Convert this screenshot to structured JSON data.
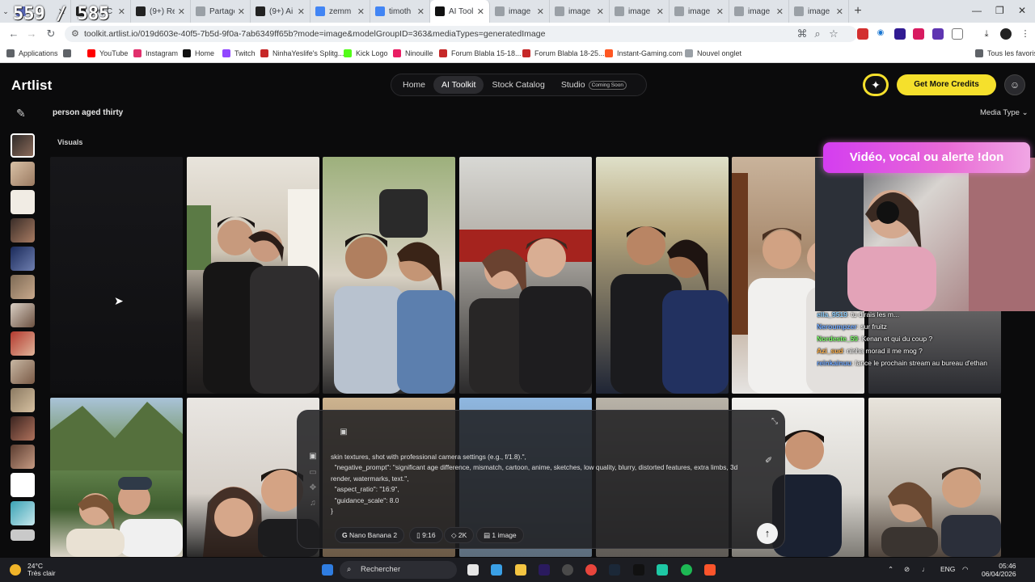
{
  "overlay_counter": "559 / 585",
  "browser": {
    "tabs": [
      {
        "title": "…",
        "color": "#5c6bc0"
      },
      {
        "title": "(9+) C",
        "color": "#222222"
      },
      {
        "title": "(9+) Re",
        "color": "#222222"
      },
      {
        "title": "Partage",
        "color": "#9aa0a6"
      },
      {
        "title": "(9+) Ai",
        "color": "#222222"
      },
      {
        "title": "zemm",
        "color": "#4285f4"
      },
      {
        "title": "timoth",
        "color": "#4285f4"
      },
      {
        "title": "AI Tool",
        "color": "#111111"
      },
      {
        "title": "image",
        "color": "#9aa0a6"
      },
      {
        "title": "image",
        "color": "#9aa0a6"
      },
      {
        "title": "image",
        "color": "#9aa0a6"
      },
      {
        "title": "image",
        "color": "#9aa0a6"
      },
      {
        "title": "image",
        "color": "#9aa0a6"
      },
      {
        "title": "image",
        "color": "#9aa0a6"
      }
    ],
    "url": "toolkit.artlist.io/019d603e-40f5-7b5d-9f0a-7ab6349ff65b?mode=image&modelGroupID=363&mediaTypes=generatedImage",
    "bookmarks": [
      {
        "label": "Applications",
        "color": "#5f6368"
      },
      {
        "label": "",
        "color": "#5f6368"
      },
      {
        "label": "YouTube",
        "color": "#ff0000"
      },
      {
        "label": "Instagram",
        "color": "#e1306c"
      },
      {
        "label": "Home",
        "color": "#111111"
      },
      {
        "label": "Twitch",
        "color": "#9146ff"
      },
      {
        "label": "NinhaYeslife's Splitg...",
        "color": "#c62828"
      },
      {
        "label": "Kick Logo",
        "color": "#53fc18"
      },
      {
        "label": "Ninouille",
        "color": "#e91e63"
      },
      {
        "label": "Forum Blabla 15-18...",
        "color": "#c62828"
      },
      {
        "label": "Forum Blabla 18-25...",
        "color": "#c62828"
      },
      {
        "label": "Instant-Gaming.com",
        "color": "#ff5722"
      },
      {
        "label": "Nouvel onglet",
        "color": "#9aa0a6"
      },
      {
        "label": "Tous les favoris",
        "color": "#5f6368"
      }
    ]
  },
  "app": {
    "logo": "Artlist",
    "nav": [
      "Home",
      "AI Toolkit",
      "Stock Catalog",
      "Studio"
    ],
    "nav_badge": "Coming Soon",
    "credits_button": "Get More Credits",
    "query": "person aged thirty",
    "media_type": "Media Type",
    "section_label": "Visuals"
  },
  "stream": {
    "alert": "Vidéo, vocal ou alerte !don",
    "chat": [
      {
        "user": "ella_9519",
        "text": "tu dirais les m...",
        "color": "#8fd0ff"
      },
      {
        "user": "Neroumpzer",
        "text": "sur fruitz",
        "color": "#6fa8ff"
      },
      {
        "user": "Nordeste_59",
        "text": "Kenan et qui du coup ?",
        "color": "#7dff6a"
      },
      {
        "user": "Azi_sud",
        "text": "ninha morad il me mog ?",
        "color": "#ffb14a"
      },
      {
        "user": "reinkainuu",
        "text": "lance le prochain stream au bureau d'ethan",
        "color": "#6fa8ff"
      }
    ]
  },
  "prompt": {
    "text": "skin textures, shot with professional camera settings (e.g., f/1.8).\",\n  \"negative_prompt\": \"significant age difference, mismatch, cartoon, anime, sketches, low quality, blurry, distorted features, extra limbs, 3d render, watermarks, text.\",\n  \"aspect_ratio\": \"16:9\",\n  \"guidance_scale\": 8.0\n}",
    "chips": [
      "Nano Banana 2",
      "9:16",
      "2K",
      "1 image"
    ]
  },
  "taskbar": {
    "temp": "24°C",
    "weather": "Très clair",
    "search": "Rechercher",
    "lang": "ENG",
    "time": "05:46",
    "date": "06/04/2026"
  }
}
